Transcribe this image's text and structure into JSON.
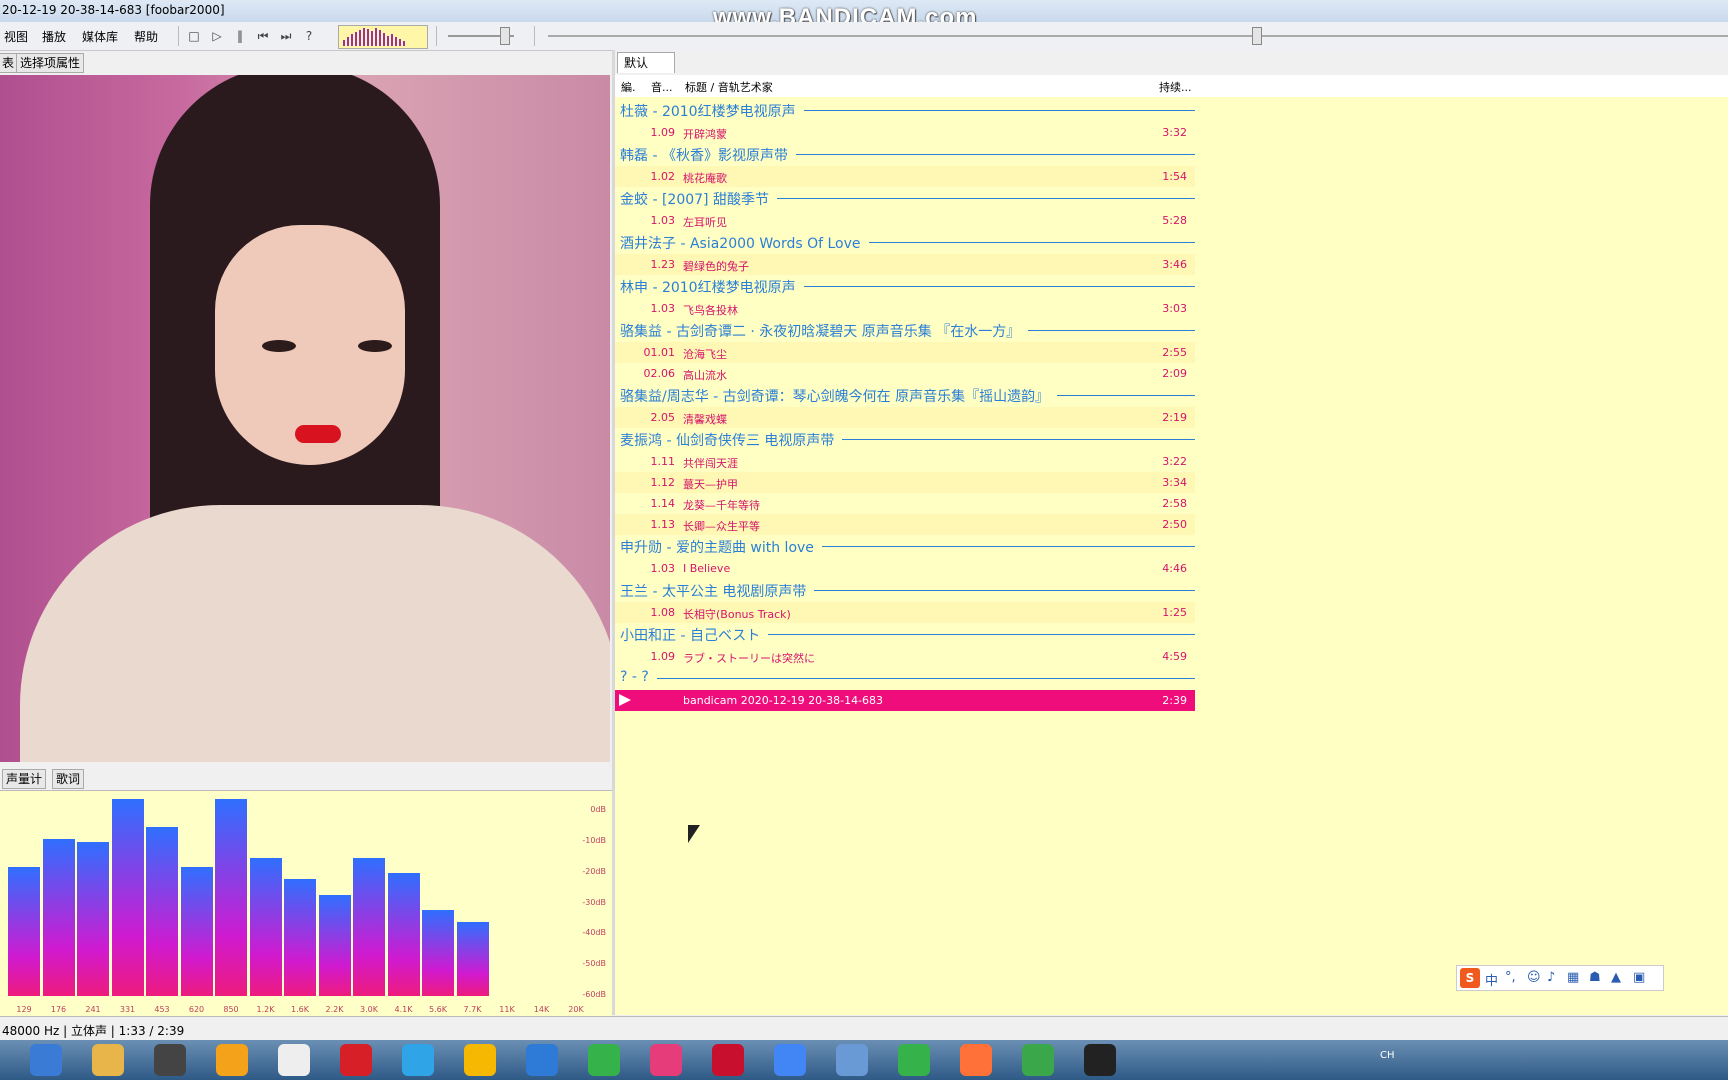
{
  "window": {
    "title": "20-12-19 20-38-14-683  [foobar2000]",
    "watermark": "www.BANDICAM.com"
  },
  "menu": [
    "视图",
    "播放",
    "媒体库",
    "帮助"
  ],
  "toolbar": {
    "buttons": [
      "stop-icon",
      "play-icon",
      "pause-icon",
      "previous-icon",
      "next-icon",
      "random-icon"
    ],
    "seek_fraction": 0.6,
    "volume_fraction": 0.85
  },
  "left_panel": {
    "top_tabs": [
      "表",
      "选择项属性"
    ],
    "bottom_tabs": [
      "声量计",
      "歌词"
    ]
  },
  "spectrum": {
    "db_labels": [
      "0dB",
      "-10dB",
      "-20dB",
      "-30dB",
      "-40dB",
      "-50dB",
      "-60dB"
    ],
    "freq_labels": [
      "129",
      "176",
      "241",
      "331",
      "453",
      "620",
      "850",
      "1.2K",
      "1.6K",
      "2.2K",
      "3.0K",
      "4.1K",
      "5.6K",
      "7.7K",
      "11K",
      "14K",
      "20K"
    ],
    "levels_db": [
      -22,
      -13,
      -14,
      0,
      -9,
      -22,
      0,
      -19,
      -26,
      -31,
      -19,
      -24,
      -36,
      -40,
      -60,
      -60,
      -60
    ]
  },
  "playlist": {
    "tab": "默认",
    "columns": {
      "num": "編.",
      "ch": "音...",
      "title": "标题 / 音轨艺术家",
      "duration": "持续..."
    },
    "groups": [
      {
        "header": "杜薇 - 2010红楼梦电视原声",
        "tracks": [
          {
            "n": "1.09",
            "t": "开辟鸿蒙",
            "d": "3:32"
          }
        ]
      },
      {
        "header": "韩磊 - 《秋香》影视原声带",
        "tracks": [
          {
            "n": "1.02",
            "t": "桃花庵歌",
            "d": "1:54"
          }
        ]
      },
      {
        "header": "金蛟 - [2007] 甜酸季节",
        "tracks": [
          {
            "n": "1.03",
            "t": "左耳听见",
            "d": "5:28"
          }
        ]
      },
      {
        "header": "酒井法子 - Asia2000 Words Of Love",
        "tracks": [
          {
            "n": "1.23",
            "t": "碧绿色的兔子",
            "d": "3:46"
          }
        ]
      },
      {
        "header": "林申 - 2010红楼梦电视原声",
        "tracks": [
          {
            "n": "1.03",
            "t": "飞鸟各投林",
            "d": "3:03"
          }
        ]
      },
      {
        "header": "骆集益 - 古剑奇谭二 · 永夜初晗凝碧天 原声音乐集 『在水一方』",
        "tracks": [
          {
            "n": "01.01",
            "t": "沧海飞尘",
            "d": "2:55"
          },
          {
            "n": "02.06",
            "t": "高山流水",
            "d": "2:09"
          }
        ]
      },
      {
        "header": "骆集益/周志华 - 古剑奇谭：琴心剑魄今何在 原声音乐集『摇山遗韵』",
        "tracks": [
          {
            "n": "2.05",
            "t": "清馨戏蝶",
            "d": "2:19"
          }
        ]
      },
      {
        "header": "麦振鸿 - 仙剑奇侠传三 电视原声带",
        "tracks": [
          {
            "n": "1.11",
            "t": "共伴闯天涯",
            "d": "3:22"
          },
          {
            "n": "1.12",
            "t": "蕞天—护甲",
            "d": "3:34"
          },
          {
            "n": "1.14",
            "t": "龙葵—千年等待",
            "d": "2:58"
          },
          {
            "n": "1.13",
            "t": "长卿—众生平等",
            "d": "2:50"
          }
        ]
      },
      {
        "header": "申升勋 - 爱的主题曲 with love",
        "tracks": [
          {
            "n": "1.03",
            "t": "I Believe",
            "d": "4:46"
          }
        ]
      },
      {
        "header": "王兰 - 太平公主 电视剧原声带",
        "tracks": [
          {
            "n": "1.08",
            "t": "长相守(Bonus Track)",
            "d": "1:25"
          }
        ]
      },
      {
        "header": "小田和正 - 自己ベスト",
        "tracks": [
          {
            "n": "1.09",
            "t": "ラブ・ストーリーは突然に",
            "d": "4:59"
          }
        ]
      },
      {
        "header": "? - ?",
        "tracks": [
          {
            "n": "",
            "t": "bandicam 2020-12-19 20-38-14-683",
            "d": "2:39",
            "playing": true
          }
        ]
      }
    ]
  },
  "status": "48000 Hz | 立体声 | 1:33 / 2:39",
  "ime": {
    "lang": "中"
  },
  "taskbar": {
    "apps": [
      "search-icon",
      "folder-icon",
      "321-player-icon",
      "headphones-icon",
      "foobar-icon",
      "netease-music-icon",
      "media-icon",
      "player-icon",
      "clock-icon",
      "iqiyi-icon",
      "youku-icon",
      "flash-icon",
      "chrome-icon",
      "bird-icon",
      "video-icon",
      "firefox-icon",
      "ie-icon",
      "record-icon"
    ],
    "tray_text": "CH"
  }
}
